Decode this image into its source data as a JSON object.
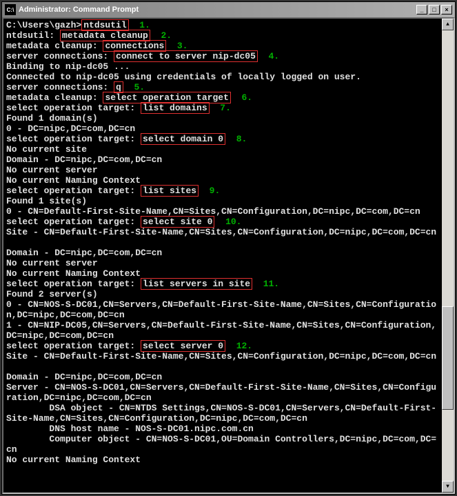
{
  "window": {
    "title": "Administrator: Command Prompt"
  },
  "steps": {
    "s1": "1.",
    "s2": "2.",
    "s3": "3.",
    "s4": "4.",
    "s5": "5.",
    "s6": "6.",
    "s7": "7.",
    "s8": "8.",
    "s9": "9.",
    "s10": "10.",
    "s11": "11.",
    "s12": "12."
  },
  "cmd": {
    "c1": "ntdsutil",
    "c2": "metadata cleanup",
    "c3": "connections",
    "c4": "connect to server nip-dc05",
    "c5": "q",
    "c6": "select operation target",
    "c7": "list domains",
    "c8": "select domain 0",
    "c9": "list sites",
    "c10": "select site 0",
    "c11": "list servers in site",
    "c12": "select server 0"
  },
  "t": {
    "l1": "C:\\Users\\gazh>",
    "l2": "ntdsutil: ",
    "l3": "metadata cleanup: ",
    "l4": "server connections: ",
    "l5": "Binding to nip-dc05 ...",
    "l6": "Connected to nip-dc05 using credentials of locally logged on user.",
    "l7": "server connections: ",
    "l8": "metadata cleanup: ",
    "l9": "select operation target: ",
    "l10": "Found 1 domain(s)",
    "l11": "0 - DC=nipc,DC=com,DC=cn",
    "l12": "select operation target: ",
    "l13": "No current site",
    "l14": "Domain - DC=nipc,DC=com,DC=cn",
    "l15": "No current server",
    "l16": "No current Naming Context",
    "l17": "select operation target: ",
    "l18": "Found 1 site(s)",
    "l19": "0 - CN=Default-First-Site-Name,CN=Sites,CN=Configuration,DC=nipc,DC=com,DC=cn",
    "l20": "select operation target: ",
    "l21": "Site - CN=Default-First-Site-Name,CN=Sites,CN=Configuration,DC=nipc,DC=com,DC=cn",
    "l22": "",
    "l23": "Domain - DC=nipc,DC=com,DC=cn",
    "l24": "No current server",
    "l25": "No current Naming Context",
    "l26": "select operation target: ",
    "l27": "Found 2 server(s)",
    "l28a": "0 - CN=NOS-S-DC01,CN=Servers,CN=Default-First-Site-Name,CN=Sites,CN=Configuratio",
    "l28b": "n,DC=nipc,DC=com,DC=cn",
    "l29a": "1 - CN=NIP-DC05,CN=Servers,CN=Default-First-Site-Name,CN=Sites,CN=Configuration,",
    "l29b": "DC=nipc,DC=com,DC=cn",
    "l30": "select operation target: ",
    "l31": "Site - CN=Default-First-Site-Name,CN=Sites,CN=Configuration,DC=nipc,DC=com,DC=cn",
    "l32": "",
    "l33": "Domain - DC=nipc,DC=com,DC=cn",
    "l34a": "Server - CN=NOS-S-DC01,CN=Servers,CN=Default-First-Site-Name,CN=Sites,CN=Configu",
    "l34b": "ration,DC=nipc,DC=com,DC=cn",
    "l35a": "        DSA object - CN=NTDS Settings,CN=NOS-S-DC01,CN=Servers,CN=Default-First-",
    "l35b": "Site-Name,CN=Sites,CN=Configuration,DC=nipc,DC=com,DC=cn",
    "l36": "        DNS host name - NOS-S-DC01.nipc.com.cn",
    "l37a": "        Computer object - CN=NOS-S-DC01,OU=Domain Controllers,DC=nipc,DC=com,DC=",
    "l37b": "cn",
    "l38": "No current Naming Context"
  },
  "scroll": {
    "up": "▲",
    "down": "▼"
  },
  "btn": {
    "min": "_",
    "max": "□",
    "close": "×"
  }
}
